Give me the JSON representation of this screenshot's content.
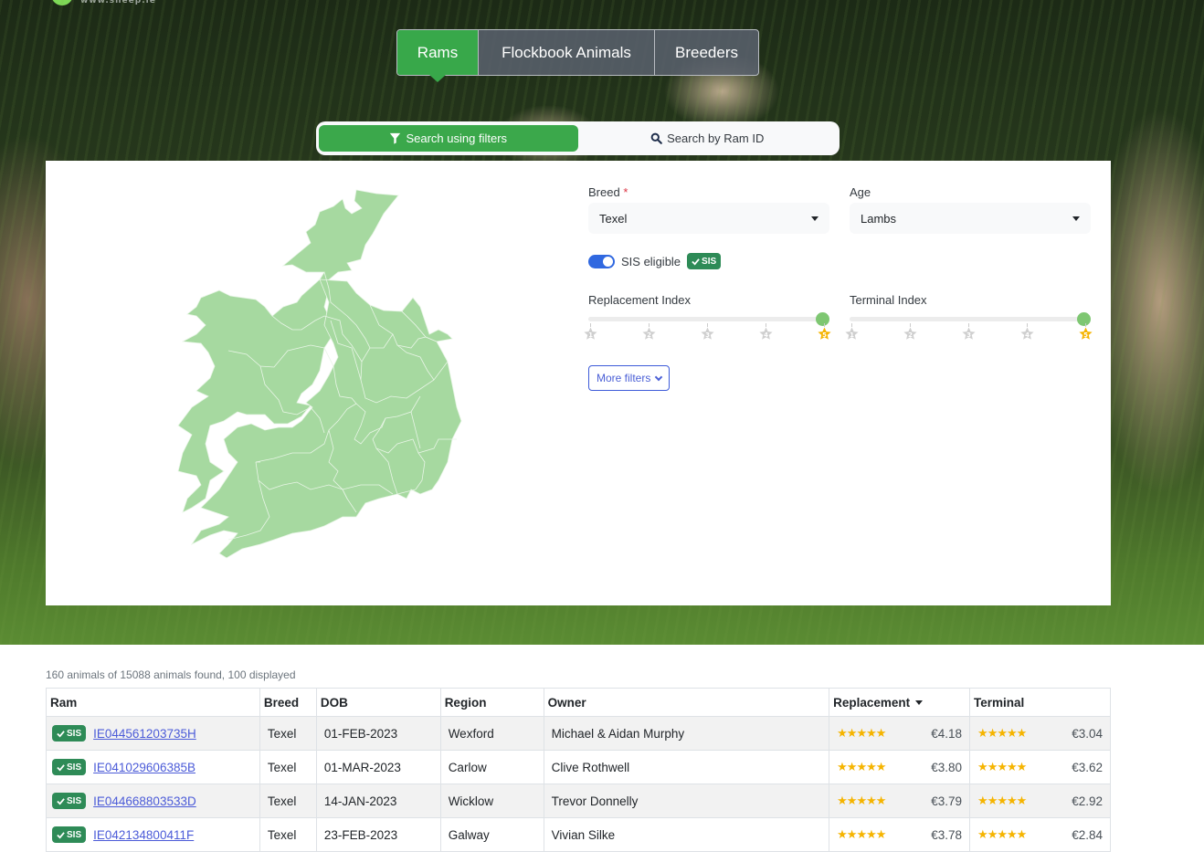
{
  "header": {
    "logo_text": "www.sheep.ie"
  },
  "main_tabs": [
    {
      "label": "Rams",
      "active": true
    },
    {
      "label": "Flockbook Animals",
      "active": false
    },
    {
      "label": "Breeders",
      "active": false
    }
  ],
  "search_mode": {
    "filters_label": "Search using filters",
    "ram_id_label": "Search by Ram ID",
    "active": "filters"
  },
  "map": {
    "fill_color": "#a6d9a0",
    "border_color": "#e8f5e6",
    "label": "Ireland county map"
  },
  "filters": {
    "breed": {
      "label": "Breed",
      "required_mark": "*",
      "value": "Texel"
    },
    "age": {
      "label": "Age",
      "value": "Lambs"
    },
    "sis_eligible": {
      "label": "SIS eligible",
      "checked": true,
      "badge": "SIS"
    },
    "replacement_index": {
      "label": "Replacement Index",
      "min": 1,
      "max": 5,
      "value": 5,
      "ticks": [
        "1",
        "2",
        "3",
        "4",
        "5"
      ]
    },
    "terminal_index": {
      "label": "Terminal Index",
      "min": 1,
      "max": 5,
      "value": 5,
      "ticks": [
        "1",
        "2",
        "3",
        "4",
        "5"
      ]
    },
    "more_filters_label": "More filters"
  },
  "results": {
    "summary": "160 animals of 15088 animals found, 100 displayed",
    "columns": [
      "Ram",
      "Breed",
      "DOB",
      "Region",
      "Owner",
      "Replacement",
      "Terminal"
    ],
    "sorted_column": "Replacement",
    "rows": [
      {
        "sis": "SIS",
        "ram_id": "IE044561203735H",
        "breed": "Texel",
        "dob": "01-FEB-2023",
        "region": "Wexford",
        "owner": "Michael & Aidan Murphy",
        "replacement_stars": 5,
        "replacement": "€4.18",
        "terminal_stars": 5,
        "terminal": "€3.04"
      },
      {
        "sis": "SIS",
        "ram_id": "IE041029606385B",
        "breed": "Texel",
        "dob": "01-MAR-2023",
        "region": "Carlow",
        "owner": "Clive Rothwell",
        "replacement_stars": 5,
        "replacement": "€3.80",
        "terminal_stars": 5,
        "terminal": "€3.62"
      },
      {
        "sis": "SIS",
        "ram_id": "IE044668803533D",
        "breed": "Texel",
        "dob": "14-JAN-2023",
        "region": "Wicklow",
        "owner": "Trevor Donnelly",
        "replacement_stars": 5,
        "replacement": "€3.79",
        "terminal_stars": 5,
        "terminal": "€2.92"
      },
      {
        "sis": "SIS",
        "ram_id": "IE042134800411F",
        "breed": "Texel",
        "dob": "23-FEB-2023",
        "region": "Galway",
        "owner": "Vivian Silke",
        "replacement_stars": 5,
        "replacement": "€3.78",
        "terminal_stars": 5,
        "terminal": "€2.84"
      }
    ],
    "star_glyph": "★★★★★"
  },
  "colors": {
    "brand_green": "#38a84a",
    "sis_green": "#2e8b57",
    "toggle_blue": "#3068e0",
    "star_gold": "#f5b400",
    "link_blue": "#4b5bd8"
  }
}
